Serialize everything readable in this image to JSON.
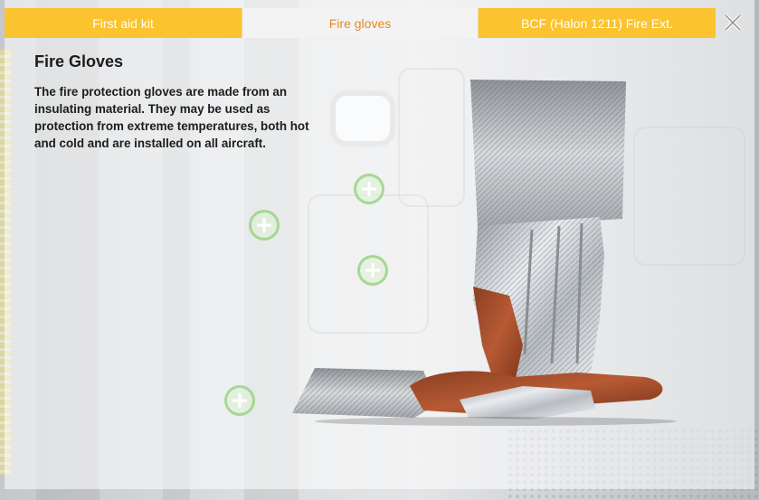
{
  "tabs": [
    {
      "label": "First aid kit",
      "active": false
    },
    {
      "label": "Fire gloves",
      "active": true
    },
    {
      "label": "BCF (Halon 1211) Fire Ext.",
      "active": false
    }
  ],
  "close_icon": "close-icon",
  "content": {
    "title": "Fire Gloves",
    "description": "The fire protection gloves are made from an insulating material. They may be used as protection from extreme temperatures, both hot and cold and are installed on all aircraft."
  },
  "hotspots": [
    {
      "icon": "plus-icon"
    },
    {
      "icon": "plus-icon"
    },
    {
      "icon": "plus-icon"
    },
    {
      "icon": "plus-icon"
    }
  ],
  "colors": {
    "tab_yellow": "#fbc32d",
    "tab_active_text": "#e58a1e",
    "hotspot_green": "#96d282"
  }
}
